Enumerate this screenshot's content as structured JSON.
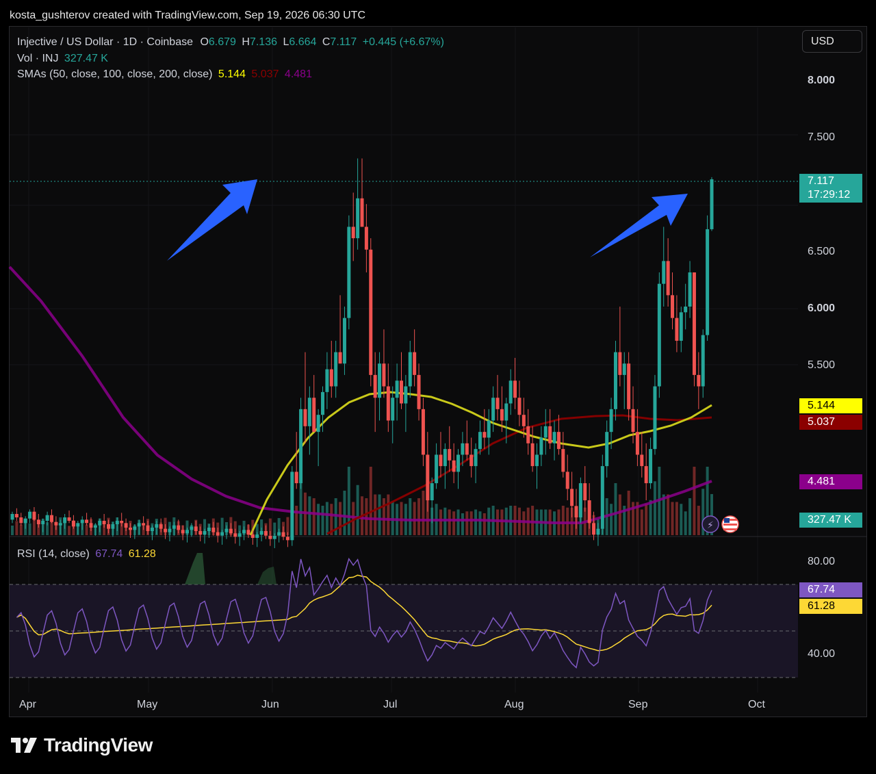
{
  "credit": "kosta_gushterov created with TradingView.com, Sep 19, 2026 06:30 UTC",
  "legend": {
    "symbol": "Injective / US Dollar · 1D · Coinbase",
    "o_label": "O",
    "o": "6.679",
    "h_label": "H",
    "h": "7.136",
    "l_label": "L",
    "l": "6.664",
    "c_label": "C",
    "c": "7.117",
    "change": "+0.445 (+6.67%)",
    "vol_label": "Vol · INJ",
    "vol": "327.47 K",
    "sma_label": "SMAs (50, close, 100, close, 200, close)",
    "sma50": "5.144",
    "sma100": "5.037",
    "sma200": "4.481",
    "rsi_label": "RSI (14, close)",
    "rsi": "67.74",
    "rsi_ma": "61.28"
  },
  "currency_button": "USD",
  "price_tags": {
    "last": "7.117",
    "countdown": "17:29:12",
    "sma50": "5.144",
    "sma100": "5.037",
    "sma200": "4.481",
    "volume": "327.47 K",
    "rsi": "67.74",
    "rsi_ma": "61.28"
  },
  "colors": {
    "up": "#26a69a",
    "down": "#ef5350",
    "sma50": "#ffff00",
    "sma100": "#8b0000",
    "sma200": "#8b008b",
    "rsi": "#7e57c2",
    "rsi_ma": "#fdd835",
    "arrow": "#2962ff"
  },
  "brand": "TradingView",
  "chart_data": {
    "type": "candlestick",
    "title": "Injective / US Dollar · 1D · Coinbase",
    "price_axis": [
      "8.000",
      "7.500",
      "6.500",
      "6.000",
      "5.500"
    ],
    "rsi_axis": [
      "80.00",
      "40.00"
    ],
    "x_ticks": [
      "Apr",
      "May",
      "Jun",
      "Jul",
      "Aug",
      "Sep",
      "Oct"
    ],
    "ylim": [
      4.0,
      8.4
    ],
    "rsi_ylim": [
      30,
      90
    ],
    "last": {
      "open": 6.679,
      "high": 7.136,
      "low": 6.664,
      "close": 7.117
    },
    "candles": [
      [
        4.13,
        4.2,
        4.1,
        4.18
      ],
      [
        4.18,
        4.23,
        4.12,
        4.15
      ],
      [
        4.15,
        4.19,
        4.08,
        4.1
      ],
      [
        4.1,
        4.16,
        4.05,
        4.14
      ],
      [
        4.14,
        4.22,
        4.1,
        4.2
      ],
      [
        4.2,
        4.24,
        4.12,
        4.13
      ],
      [
        4.13,
        4.18,
        4.06,
        4.09
      ],
      [
        4.09,
        4.14,
        4.02,
        4.12
      ],
      [
        4.12,
        4.2,
        4.08,
        4.17
      ],
      [
        4.17,
        4.22,
        4.1,
        4.11
      ],
      [
        4.11,
        4.16,
        4.04,
        4.08
      ],
      [
        4.08,
        4.13,
        4.0,
        4.1
      ],
      [
        4.1,
        4.18,
        4.05,
        4.15
      ],
      [
        4.15,
        4.21,
        4.1,
        4.12
      ],
      [
        4.12,
        4.17,
        4.05,
        4.07
      ],
      [
        4.07,
        4.12,
        4.0,
        4.1
      ],
      [
        4.1,
        4.16,
        4.04,
        4.13
      ],
      [
        4.13,
        4.19,
        4.08,
        4.1
      ],
      [
        4.1,
        4.15,
        4.03,
        4.06
      ],
      [
        4.06,
        4.1,
        3.99,
        4.08
      ],
      [
        4.08,
        4.14,
        4.02,
        4.12
      ],
      [
        4.12,
        4.18,
        4.06,
        4.09
      ],
      [
        4.09,
        4.13,
        4.01,
        4.05
      ],
      [
        4.05,
        4.11,
        3.98,
        4.09
      ],
      [
        4.09,
        4.15,
        4.03,
        4.12
      ],
      [
        4.12,
        4.19,
        4.07,
        4.1
      ],
      [
        4.1,
        4.14,
        4.03,
        4.06
      ],
      [
        4.06,
        4.1,
        3.97,
        4.04
      ],
      [
        4.04,
        4.09,
        3.96,
        4.07
      ],
      [
        4.07,
        4.13,
        4.0,
        4.1
      ],
      [
        4.1,
        4.16,
        4.04,
        4.08
      ],
      [
        4.08,
        4.12,
        4.0,
        4.03
      ],
      [
        4.03,
        4.08,
        3.95,
        4.06
      ],
      [
        4.06,
        4.12,
        4.0,
        4.09
      ],
      [
        4.09,
        4.14,
        4.02,
        4.05
      ],
      [
        4.05,
        4.09,
        3.96,
        4.02
      ],
      [
        4.02,
        4.07,
        3.94,
        4.05
      ],
      [
        4.05,
        4.11,
        3.99,
        4.08
      ],
      [
        4.08,
        4.13,
        4.01,
        4.04
      ],
      [
        4.04,
        4.08,
        3.95,
        4.01
      ],
      [
        4.01,
        4.06,
        3.93,
        4.04
      ],
      [
        4.04,
        4.1,
        3.98,
        4.07
      ],
      [
        4.07,
        4.12,
        4.0,
        4.03
      ],
      [
        4.03,
        4.07,
        3.94,
        4.0
      ],
      [
        4.0,
        4.05,
        3.92,
        4.03
      ],
      [
        4.03,
        4.09,
        3.97,
        4.06
      ],
      [
        4.06,
        4.11,
        3.99,
        4.02
      ],
      [
        4.02,
        4.06,
        3.93,
        3.99
      ],
      [
        3.99,
        4.04,
        3.91,
        4.02
      ],
      [
        4.02,
        4.08,
        3.96,
        4.05
      ],
      [
        4.05,
        4.1,
        3.98,
        4.01
      ],
      [
        4.01,
        4.05,
        3.92,
        3.98
      ],
      [
        3.98,
        4.03,
        3.9,
        4.01
      ],
      [
        4.01,
        4.07,
        3.95,
        4.04
      ],
      [
        4.04,
        4.09,
        3.97,
        4.0
      ],
      [
        4.0,
        4.04,
        3.91,
        3.97
      ],
      [
        3.97,
        4.02,
        3.89,
        4.0
      ],
      [
        4.0,
        4.06,
        3.94,
        4.03
      ],
      [
        4.03,
        4.08,
        3.96,
        3.99
      ],
      [
        3.99,
        4.03,
        3.9,
        3.96
      ],
      [
        3.96,
        4.01,
        3.88,
        3.99
      ],
      [
        3.99,
        4.05,
        3.93,
        4.02
      ],
      [
        4.02,
        4.07,
        3.95,
        3.98
      ],
      [
        3.98,
        4.02,
        3.89,
        3.95
      ],
      [
        3.95,
        4.6,
        3.9,
        4.55
      ],
      [
        4.55,
        4.9,
        4.4,
        4.45
      ],
      [
        4.45,
        5.2,
        4.4,
        5.1
      ],
      [
        5.1,
        5.6,
        4.8,
        4.95
      ],
      [
        4.95,
        5.3,
        4.7,
        5.2
      ],
      [
        5.2,
        5.4,
        4.9,
        4.9
      ],
      [
        4.9,
        5.1,
        4.6,
        5.05
      ],
      [
        5.05,
        5.3,
        4.9,
        5.25
      ],
      [
        5.25,
        5.6,
        5.1,
        5.45
      ],
      [
        5.45,
        5.7,
        5.2,
        5.3
      ],
      [
        5.3,
        5.7,
        5.2,
        5.6
      ],
      [
        5.6,
        6.1,
        5.5,
        5.5
      ],
      [
        5.5,
        6.0,
        5.4,
        5.9
      ],
      [
        5.9,
        6.8,
        5.8,
        6.7
      ],
      [
        6.7,
        7.0,
        6.4,
        6.6
      ],
      [
        6.6,
        7.3,
        6.5,
        6.95
      ],
      [
        6.95,
        7.3,
        6.7,
        6.7
      ],
      [
        6.7,
        6.9,
        6.3,
        6.5
      ],
      [
        6.5,
        6.6,
        5.3,
        5.4
      ],
      [
        5.4,
        5.6,
        4.9,
        5.2
      ],
      [
        5.2,
        5.6,
        5.0,
        5.5
      ],
      [
        5.5,
        5.8,
        5.2,
        5.3
      ],
      [
        5.3,
        5.5,
        4.9,
        5.0
      ],
      [
        5.0,
        5.3,
        4.8,
        5.2
      ],
      [
        5.2,
        5.5,
        5.0,
        5.35
      ],
      [
        5.35,
        5.6,
        5.1,
        5.15
      ],
      [
        5.15,
        5.4,
        4.9,
        5.3
      ],
      [
        5.3,
        5.7,
        5.2,
        5.6
      ],
      [
        5.6,
        5.8,
        5.3,
        5.4
      ],
      [
        5.4,
        5.5,
        5.0,
        5.1
      ],
      [
        5.1,
        5.2,
        4.6,
        4.7
      ],
      [
        4.7,
        4.9,
        4.2,
        4.3
      ],
      [
        4.3,
        4.5,
        4.1,
        4.45
      ],
      [
        4.45,
        4.8,
        4.4,
        4.7
      ],
      [
        4.7,
        4.9,
        4.5,
        4.6
      ],
      [
        4.6,
        4.8,
        4.4,
        4.75
      ],
      [
        4.75,
        4.95,
        4.55,
        4.65
      ],
      [
        4.65,
        4.8,
        4.45,
        4.55
      ],
      [
        4.55,
        4.75,
        4.4,
        4.7
      ],
      [
        4.7,
        4.9,
        4.6,
        4.8
      ],
      [
        4.8,
        5.0,
        4.65,
        4.7
      ],
      [
        4.7,
        4.85,
        4.5,
        4.6
      ],
      [
        4.6,
        4.8,
        4.45,
        4.75
      ],
      [
        4.75,
        5.0,
        4.7,
        4.9
      ],
      [
        4.9,
        5.1,
        4.75,
        4.85
      ],
      [
        4.85,
        5.1,
        4.7,
        5.0
      ],
      [
        5.0,
        5.3,
        4.9,
        5.2
      ],
      [
        5.2,
        5.4,
        5.0,
        5.1
      ],
      [
        5.1,
        5.3,
        4.9,
        5.0
      ],
      [
        5.0,
        5.2,
        4.8,
        5.15
      ],
      [
        5.15,
        5.45,
        5.05,
        5.35
      ],
      [
        5.35,
        5.55,
        5.1,
        5.2
      ],
      [
        5.2,
        5.35,
        4.95,
        5.05
      ],
      [
        5.05,
        5.2,
        4.85,
        4.95
      ],
      [
        4.95,
        5.1,
        4.7,
        4.8
      ],
      [
        4.8,
        4.95,
        4.55,
        4.6
      ],
      [
        4.6,
        4.8,
        4.4,
        4.7
      ],
      [
        4.7,
        4.95,
        4.6,
        4.85
      ],
      [
        4.85,
        5.1,
        4.7,
        4.95
      ],
      [
        4.95,
        5.1,
        4.75,
        4.8
      ],
      [
        4.8,
        5.0,
        4.65,
        4.9
      ],
      [
        4.9,
        5.05,
        4.7,
        4.75
      ],
      [
        4.75,
        4.9,
        4.5,
        4.55
      ],
      [
        4.55,
        4.7,
        4.3,
        4.4
      ],
      [
        4.4,
        4.55,
        4.15,
        4.25
      ],
      [
        4.25,
        4.4,
        4.05,
        4.15
      ],
      [
        4.15,
        4.5,
        4.1,
        4.45
      ],
      [
        4.45,
        4.6,
        4.2,
        4.3
      ],
      [
        4.3,
        4.45,
        4.05,
        4.1
      ],
      [
        4.1,
        4.2,
        3.95,
        4.0
      ],
      [
        4.0,
        4.1,
        3.9,
        4.05
      ],
      [
        4.05,
        4.7,
        4.0,
        4.6
      ],
      [
        4.6,
        5.0,
        4.5,
        4.9
      ],
      [
        4.9,
        5.2,
        4.75,
        5.1
      ],
      [
        5.1,
        5.7,
        5.0,
        5.6
      ],
      [
        5.6,
        6.0,
        5.3,
        5.4
      ],
      [
        5.4,
        5.6,
        5.1,
        5.5
      ],
      [
        5.5,
        5.6,
        5.0,
        5.1
      ],
      [
        5.1,
        5.3,
        4.8,
        4.9
      ],
      [
        4.9,
        5.1,
        4.6,
        4.7
      ],
      [
        4.7,
        4.9,
        4.5,
        4.6
      ],
      [
        4.6,
        4.8,
        4.3,
        4.45
      ],
      [
        4.45,
        4.85,
        4.4,
        4.75
      ],
      [
        4.75,
        5.4,
        4.7,
        5.3
      ],
      [
        5.3,
        6.3,
        5.2,
        6.2
      ],
      [
        6.2,
        6.7,
        6.0,
        6.4
      ],
      [
        6.4,
        6.6,
        6.0,
        6.1
      ],
      [
        6.1,
        6.3,
        5.8,
        5.9
      ],
      [
        5.9,
        6.1,
        5.6,
        5.7
      ],
      [
        5.7,
        6.0,
        5.6,
        5.95
      ],
      [
        5.95,
        6.2,
        5.8,
        6.0
      ],
      [
        6.0,
        6.4,
        5.9,
        6.3
      ],
      [
        6.3,
        6.3,
        5.3,
        5.4
      ],
      [
        5.4,
        5.6,
        5.1,
        5.3
      ],
      [
        5.3,
        5.8,
        5.2,
        5.75
      ],
      [
        5.75,
        6.8,
        5.7,
        6.679
      ],
      [
        6.679,
        7.136,
        6.664,
        7.117
      ]
    ],
    "volume_last": "327.47 K",
    "sma50_last": 5.144,
    "sma100_last": 5.037,
    "sma200_last": 4.481,
    "rsi_last": 67.74,
    "rsi_ma_last": 61.28
  }
}
